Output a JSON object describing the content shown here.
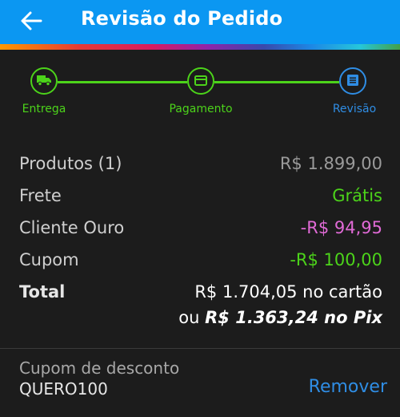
{
  "header": {
    "title": "Revisão do Pedido",
    "background": "#0b97f2"
  },
  "stepper": {
    "steps": [
      {
        "label": "Entrega",
        "icon": "truck-icon",
        "state": "completed"
      },
      {
        "label": "Pagamento",
        "icon": "card-icon",
        "state": "completed"
      },
      {
        "label": "Revisão",
        "icon": "list-icon",
        "state": "active"
      }
    ],
    "completed_color": "#4cd31a",
    "active_color": "#2f8de4"
  },
  "summary": {
    "products": {
      "label": "Produtos (1)",
      "value": "R$ 1.899,00",
      "color": "#9a9a9a"
    },
    "shipping": {
      "label": "Frete",
      "value": "Grátis",
      "color": "#4cd31a"
    },
    "gold_client": {
      "label": "Cliente Ouro",
      "value": "-R$ 94,95",
      "color": "#e06ad6"
    },
    "coupon": {
      "label": "Cupom",
      "value": "-R$ 100,00",
      "color": "#4cd31a"
    },
    "total": {
      "label": "Total",
      "card_text": "R$ 1.704,05 no cartão",
      "pix_prefix": "ou",
      "pix_text": "R$ 1.363,24 no Pix"
    }
  },
  "coupon_section": {
    "label": "Cupom de desconto",
    "code": "QUERO100",
    "remove_label": "Remover"
  }
}
